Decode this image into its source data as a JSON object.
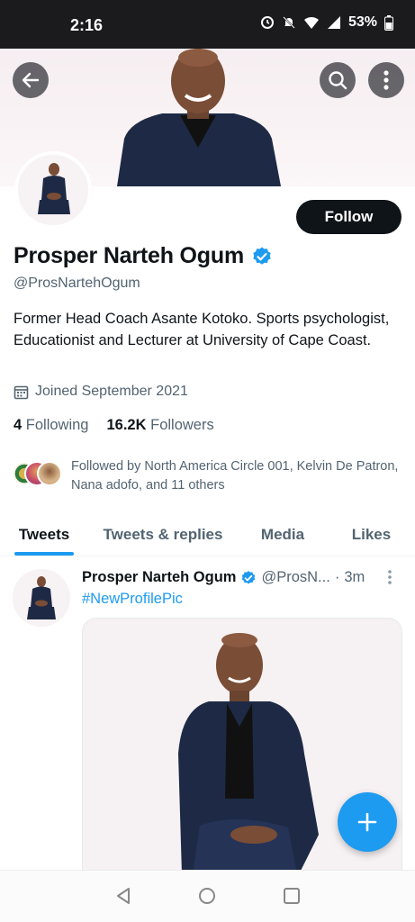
{
  "status_bar": {
    "time": "2:16",
    "battery": "53%"
  },
  "profile": {
    "name": "Prosper Narteh Ogum",
    "handle": "@ProsNartehOgum",
    "bio": "Former Head Coach Asante Kotoko. Sports psychologist, Educationist and Lecturer at University of Cape Coast.",
    "joined": "Joined September 2021",
    "following_count": "4",
    "following_label": "Following",
    "followers_count": "16.2K",
    "followers_label": "Followers",
    "followed_by": "Followed by North America Circle 001, Kelvin De Patron, Nana adofo, and 11 others",
    "follow_button": "Follow",
    "verified_color": "#1d9bf0"
  },
  "tabs": [
    {
      "label": "Tweets",
      "active": true
    },
    {
      "label": "Tweets & replies",
      "active": false
    },
    {
      "label": "Media",
      "active": false
    },
    {
      "label": "Likes",
      "active": false
    }
  ],
  "tweet": {
    "author_name": "Prosper Narteh Ogum",
    "author_handle": "@ProsN...",
    "separator": "·",
    "time": "3m",
    "text": "#NewProfilePic"
  },
  "icons": {
    "back": "arrow-left-icon",
    "search": "search-icon",
    "more": "more-vertical-icon",
    "calendar": "calendar-icon",
    "verified": "verified-badge-icon",
    "compose": "plus-icon"
  },
  "colors": {
    "accent": "#1d9bf0",
    "text_primary": "#0f1419",
    "text_secondary": "#536471"
  }
}
